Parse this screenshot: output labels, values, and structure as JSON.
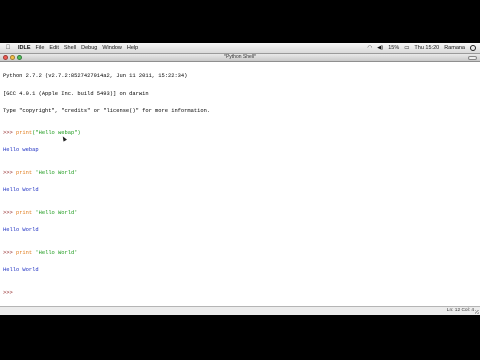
{
  "menubar": {
    "apple_icon": "apple-icon",
    "items": [
      "IDLE",
      "File",
      "Edit",
      "Shell",
      "Debug",
      "Window",
      "Help"
    ],
    "tray": {
      "battery": "15%",
      "clock": "Thu 15:20",
      "user": "Ramana"
    }
  },
  "window": {
    "title": "*Python Shell*"
  },
  "console": {
    "banner": [
      "Python 2.7.2 (v2.7.2:8527427914a2, Jun 11 2011, 15:22:34)",
      "[GCC 4.0.1 (Apple Inc. build 5493)] on darwin",
      "Type \"copyright\", \"credits\" or \"license()\" for more information."
    ],
    "prompt": ">>> ",
    "entries": [
      {
        "keyword": "print",
        "string": "(\"Hello webap\")",
        "output": "Hello webap"
      },
      {
        "keyword": "print",
        "string": " 'Hello World'",
        "output": "Hello World"
      },
      {
        "keyword": "print",
        "string": " 'Hello World'",
        "output": "Hello World"
      },
      {
        "keyword": "print",
        "string": " 'Hello World'",
        "output": "Hello World"
      }
    ],
    "last_prompt": ">>> "
  },
  "status": {
    "position": "Ln: 12 Col: 4"
  },
  "colors": {
    "prompt": "#8b1a1a",
    "keyword": "#e07a18",
    "string": "#1a9a1a",
    "output": "#1d2fc2"
  }
}
